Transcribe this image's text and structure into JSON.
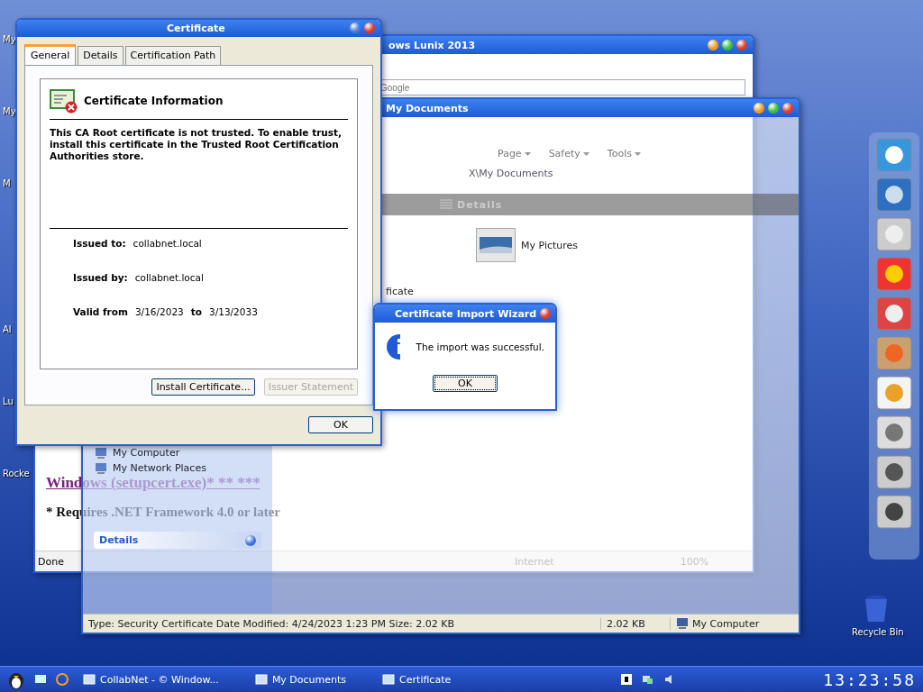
{
  "desktop_icons": [
    {
      "label": "My"
    },
    {
      "label": "My"
    },
    {
      "label": "M"
    },
    {
      "label": "Al"
    },
    {
      "label": "Lu"
    },
    {
      "label": "Rocke"
    }
  ],
  "recycle_bin": {
    "label": "Recycle Bin"
  },
  "browser_window": {
    "title": "ows Lunix 2013",
    "search": {
      "placeholder": "Google"
    },
    "command_bar": [
      "Page",
      "Safety",
      "Tools"
    ],
    "content": [
      {
        "kind": "link",
        "text": "Windows (setupcert.exe)* ** ***"
      },
      {
        "kind": "note",
        "text": "* Requires .NET Framework 4.0 or later"
      }
    ],
    "status": "Done",
    "zone": "Internet",
    "zoom": "100%"
  },
  "documents_window": {
    "title": "My Documents",
    "address": "X\\My Documents",
    "view_button": "Details",
    "items": [
      {
        "kind": "folder",
        "label": "My Pictures"
      },
      {
        "kind": "file",
        "label": "ficate"
      }
    ],
    "places": [
      "My Computer",
      "My Network Places"
    ],
    "details_panel": "Details",
    "status_bar": [
      "Type: Security Certificate Date Modified: 4/24/2023 1:23 PM Size: 2.02 KB",
      "2.02 KB",
      "My Computer"
    ]
  },
  "certificate_dialog": {
    "title": "Certificate",
    "tabs": [
      {
        "label": "General",
        "selected": true
      },
      {
        "label": "Details",
        "selected": false
      },
      {
        "label": "Certification Path",
        "selected": false
      }
    ],
    "heading": "Certificate Information",
    "message": "This CA Root certificate is not trusted. To enable trust, install this certificate in the Trusted Root Certification Authorities store.",
    "fields": [
      {
        "label": "Issued to:",
        "value": "collabnet.local"
      },
      {
        "label": "Issued by:",
        "value": "collabnet.local"
      }
    ],
    "validity": {
      "label": "Valid from",
      "from": "3/16/2023",
      "to_label": "to",
      "to": "3/13/2033"
    },
    "buttons": [
      {
        "label": "Install Certificate...",
        "disabled": false
      },
      {
        "label": "Issuer Statement",
        "disabled": true
      }
    ],
    "ok": "OK"
  },
  "import_wizard": {
    "title": "Certificate Import Wizard",
    "message": "The import was successful.",
    "ok": "OK"
  },
  "taskbar": {
    "tasks": [
      "CollabNet - © Window...",
      "My Documents",
      "Certificate"
    ],
    "clock": "13:23:58"
  }
}
